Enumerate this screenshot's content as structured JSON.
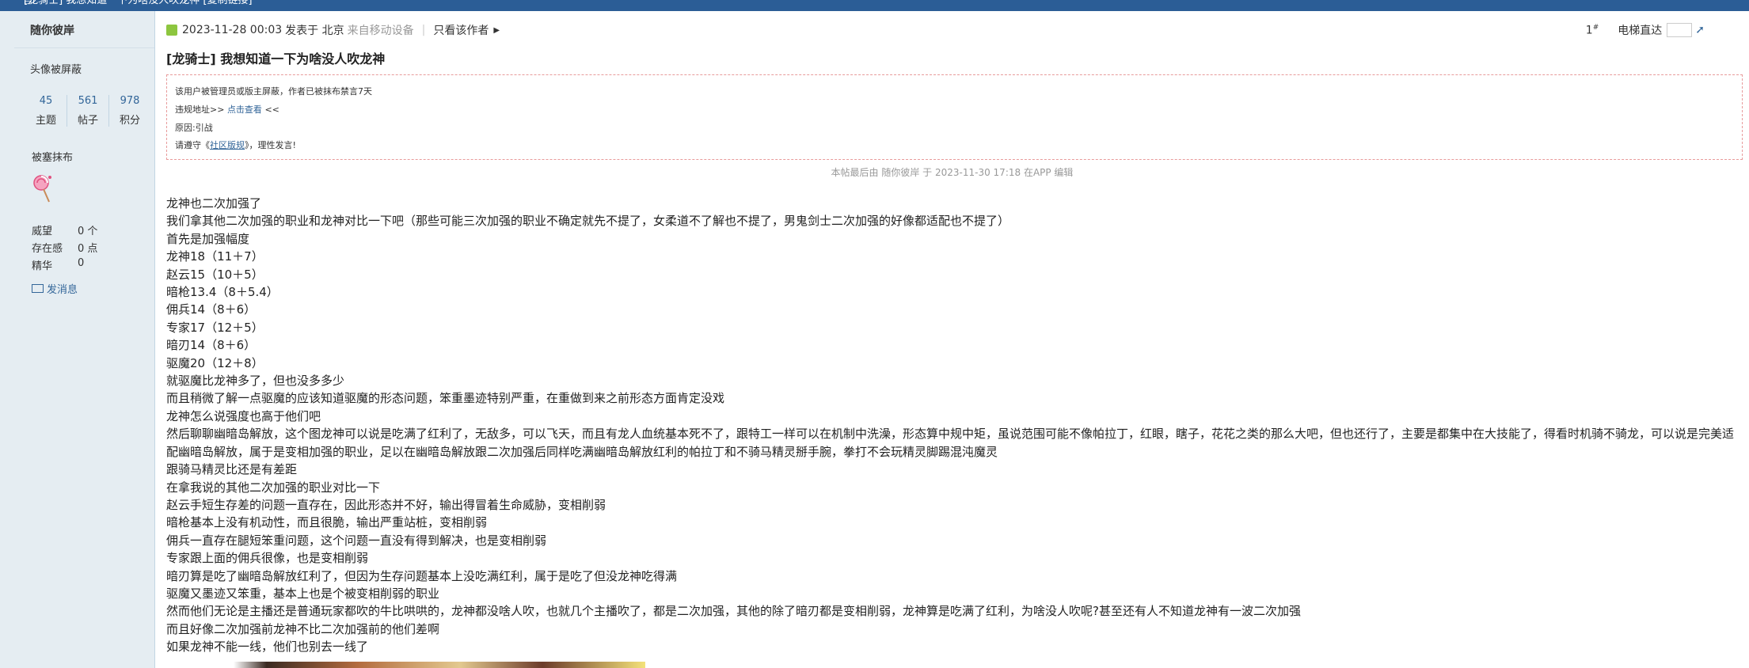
{
  "window": {
    "title": "[龙骑士] 我想知道一下为啥没人吹龙神 [复制链接]"
  },
  "sidebar": {
    "author": "随你彼岸",
    "avatar_text": "头像被屏蔽",
    "stats": [
      {
        "value": "45",
        "label": "主题"
      },
      {
        "value": "561",
        "label": "帖子"
      },
      {
        "value": "978",
        "label": "积分"
      }
    ],
    "usergroup": "被塞抹布",
    "profile": [
      {
        "key": "威望",
        "value": "0 个"
      },
      {
        "key": "存在感",
        "value": "0 点"
      },
      {
        "key": "精华",
        "value": "0"
      }
    ],
    "send_message": "发消息"
  },
  "post": {
    "date": "2023-11-28 00:03",
    "posted_in": "发表于 北京",
    "device": "来自移动设备",
    "only_author": "只看该作者",
    "floor": "1",
    "floor_suffix": "#",
    "jump_label": "电梯直达",
    "title": "[龙骑士] 我想知道一下为啥没人吹龙神",
    "notice": {
      "line1": "该用户被管理员或版主屏蔽，作者已被抹布禁言7天",
      "line2_prefix": "违规地址>>",
      "line2_link": "点击查看",
      "line2_suffix": "<<",
      "line3": "原因:引战",
      "line4_prefix": "请遵守《",
      "line4_link": "社区版规",
      "line4_suffix": "》，理性发言!"
    },
    "last_edit": "本帖最后由 随你彼岸 于 2023-11-30 17:18 在APP 编辑",
    "content": [
      "龙神也二次加强了",
      "我们拿其他二次加强的职业和龙神对比一下吧（那些可能三次加强的职业不确定就先不提了，女柔道不了解也不提了，男鬼剑士二次加强的好像都适配也不提了）",
      "首先是加强幅度",
      "龙神18（11＋7）",
      "赵云15（10＋5）",
      "暗枪13.4（8＋5.4）",
      "佣兵14（8＋6）",
      "专家17（12＋5）",
      "暗刃14（8＋6）",
      "驱魔20（12＋8）",
      "就驱魔比龙神多了，但也没多多少",
      "而且稍微了解一点驱魔的应该知道驱魔的形态问题，笨重墨迹特别严重，在重做到来之前形态方面肯定没戏",
      "龙神怎么说强度也高于他们吧",
      "然后聊聊幽暗岛解放，这个图龙神可以说是吃满了红利了，无敌多，可以飞天，而且有龙人血统基本死不了，跟特工一样可以在机制中洗澡，形态算中规中矩，虽说范围可能不像帕拉丁，红眼，瞎子，花花之类的那么大吧，但也还行了，主要是都集中在大技能了，得看时机骑不骑龙，可以说是完美适配幽暗岛解放，属于是变相加强的职业，足以在幽暗岛解放跟二次加强后同样吃满幽暗岛解放红利的帕拉丁和不骑马精灵掰手腕，拳打不会玩精灵脚踢混沌魔灵",
      "跟骑马精灵比还是有差距",
      "在拿我说的其他二次加强的职业对比一下",
      "赵云手短生存差的问题一直存在，因此形态并不好，输出得冒着生命威胁，变相削弱",
      "暗枪基本上没有机动性，而且很脆，输出严重站桩，变相削弱",
      "佣兵一直存在腿短笨重问题，这个问题一直没有得到解决，也是变相削弱",
      "专家跟上面的佣兵很像，也是变相削弱",
      "暗刃算是吃了幽暗岛解放红利了，但因为生存问题基本上没吃满红利，属于是吃了但没龙神吃得满",
      "驱魔又墨迹又笨重，基本上也是个被变相削弱的职业",
      "然而他们无论是主播还是普通玩家都吹的牛比哄哄的，龙神都没啥人吹，也就几个主播吹了，都是二次加强，其他的除了暗刃都是变相削弱，龙神算是吃满了红利，为啥没人吹呢?甚至还有人不知道龙神有一波二次加强",
      "而且好像二次加强前龙神不比二次加强前的他们差啊",
      "如果龙神不能一线，他们也别去一线了"
    ]
  }
}
